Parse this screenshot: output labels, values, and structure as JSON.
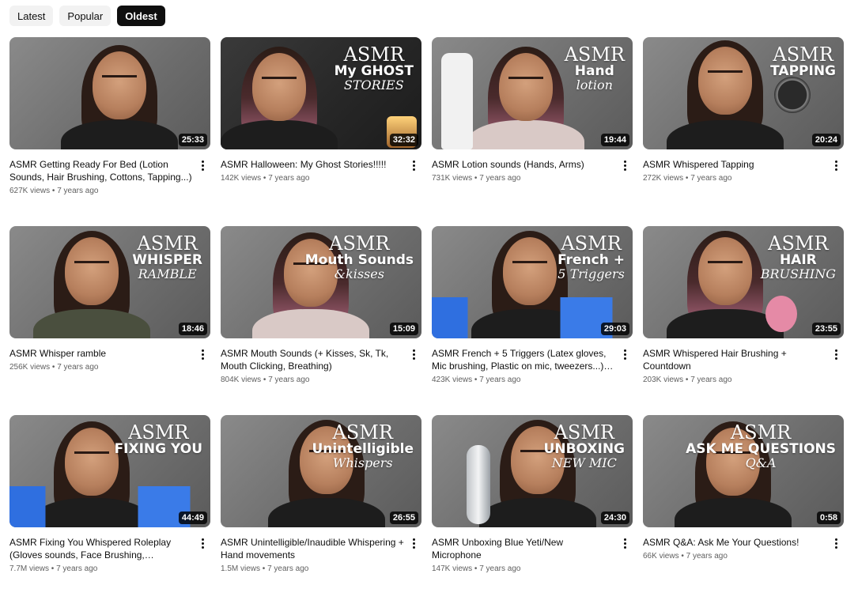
{
  "filters": [
    {
      "label": "Latest",
      "active": false
    },
    {
      "label": "Popular",
      "active": false
    },
    {
      "label": "Oldest",
      "active": true
    }
  ],
  "videos": [
    {
      "title": "ASMR Getting Ready For Bed (Lotion Sounds, Hair Brushing, Cottons, Tapping...)",
      "views": "627K views",
      "age": "7 years ago",
      "duration": "25:33",
      "overlay": [],
      "theme": "light"
    },
    {
      "title": "ASMR Halloween: My Ghost Stories!!!!!",
      "views": "142K views",
      "age": "7 years ago",
      "duration": "32:32",
      "overlay": [
        "ASMR",
        "My GHOST",
        "STORIES"
      ],
      "theme": "dark"
    },
    {
      "title": "ASMR Lotion sounds (Hands, Arms)",
      "views": "731K views",
      "age": "7 years ago",
      "duration": "19:44",
      "overlay": [
        "ASMR",
        "Hand",
        "lotion"
      ],
      "theme": "light"
    },
    {
      "title": "ASMR Whispered Tapping",
      "views": "272K views",
      "age": "7 years ago",
      "duration": "20:24",
      "overlay": [
        "ASMR",
        "TAPPING"
      ],
      "theme": "light"
    },
    {
      "title": "ASMR Whisper ramble",
      "views": "256K views",
      "age": "7 years ago",
      "duration": "18:46",
      "overlay": [
        "ASMR",
        "WHISPER",
        "RAMBLE"
      ],
      "theme": "light"
    },
    {
      "title": "ASMR Mouth Sounds (+ Kisses, Sk, Tk, Mouth Clicking, Breathing)",
      "views": "804K views",
      "age": "7 years ago",
      "duration": "15:09",
      "overlay": [
        "ASMR",
        "Mouth Sounds",
        "&kisses"
      ],
      "theme": "light"
    },
    {
      "title": "ASMR French + 5 Triggers (Latex gloves, Mic brushing, Plastic on mic, tweezers...) | ASM...",
      "views": "423K views",
      "age": "7 years ago",
      "duration": "29:03",
      "overlay": [
        "ASMR",
        "French +",
        "5 Triggers"
      ],
      "theme": "light"
    },
    {
      "title": "ASMR Whispered Hair Brushing + Countdown",
      "views": "203K views",
      "age": "7 years ago",
      "duration": "23:55",
      "overlay": [
        "ASMR",
        "HAIR",
        "BRUSHING"
      ],
      "theme": "light"
    },
    {
      "title": "ASMR Fixing You Whispered Roleplay (Gloves sounds, Face Brushing, Scratching...",
      "views": "7.7M views",
      "age": "7 years ago",
      "duration": "44:49",
      "overlay": [
        "ASMR",
        "FIXING YOU"
      ],
      "theme": "light"
    },
    {
      "title": "ASMR Unintelligible/Inaudible Whispering + Hand movements",
      "views": "1.5M views",
      "age": "7 years ago",
      "duration": "26:55",
      "overlay": [
        "ASMR",
        "Unintelligible",
        "Whispers"
      ],
      "theme": "light"
    },
    {
      "title": "ASMR Unboxing Blue Yeti/New Microphone",
      "views": "147K views",
      "age": "7 years ago",
      "duration": "24:30",
      "overlay": [
        "ASMR",
        "UNBOXING",
        "NEW MIC"
      ],
      "theme": "light"
    },
    {
      "title": "ASMR Q&A: Ask Me Your Questions!",
      "views": "66K views",
      "age": "7 years ago",
      "duration": "0:58",
      "overlay": [
        "ASMR",
        "ASK ME QUESTIONS",
        "Q&A"
      ],
      "theme": "light"
    }
  ],
  "icons": {
    "more": "more-vert-icon"
  }
}
